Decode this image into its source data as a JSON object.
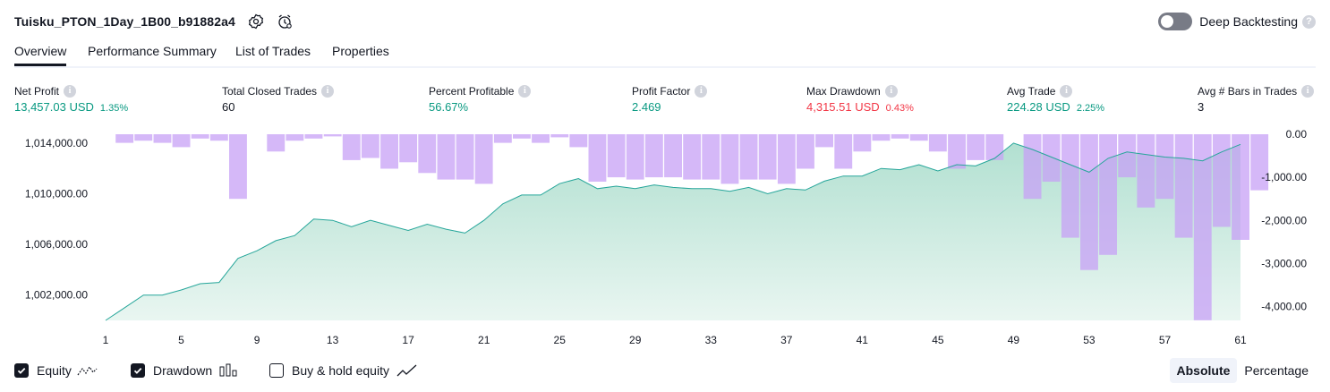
{
  "header": {
    "title": "Tuisku_PTON_1Day_1B00_b91882a4",
    "deep_backtesting_label": "Deep Backtesting",
    "deep_backtesting_enabled": false
  },
  "tabs": [
    {
      "label": "Overview",
      "active": true
    },
    {
      "label": "Performance Summary",
      "active": false
    },
    {
      "label": "List of Trades",
      "active": false
    },
    {
      "label": "Properties",
      "active": false
    }
  ],
  "metrics": [
    {
      "label": "Net Profit",
      "value": "13,457.03 USD",
      "sub": "1.35%",
      "color": "#089981"
    },
    {
      "label": "Total Closed Trades",
      "value": "60",
      "sub": "",
      "color": "#131722"
    },
    {
      "label": "Percent Profitable",
      "value": "56.67%",
      "sub": "",
      "color": "#089981"
    },
    {
      "label": "Profit Factor",
      "value": "2.469",
      "sub": "",
      "color": "#089981"
    },
    {
      "label": "Max Drawdown",
      "value": "4,315.51 USD",
      "sub": "0.43%",
      "color": "#f23645"
    },
    {
      "label": "Avg Trade",
      "value": "224.28 USD",
      "sub": "2.25%",
      "color": "#089981"
    },
    {
      "label": "Avg # Bars in Trades",
      "value": "3",
      "sub": "",
      "color": "#131722"
    }
  ],
  "chart_data": {
    "type": "area",
    "x_ticks": [
      "1",
      "5",
      "9",
      "13",
      "17",
      "21",
      "25",
      "29",
      "33",
      "37",
      "41",
      "45",
      "49",
      "53",
      "57",
      "61"
    ],
    "left_axis_ticks": [
      "1,014,000.00",
      "1,010,000.00",
      "1,006,000.00",
      "1,002,000.00"
    ],
    "right_axis_ticks": [
      "0.00",
      "-1,000.00",
      "-2,000.00",
      "-3,000.00",
      "-4,000.00"
    ],
    "equity_ylim": [
      1000000,
      1014700
    ],
    "drawdown_ylim": [
      -4320,
      0
    ],
    "trades": [
      1,
      2,
      3,
      4,
      5,
      6,
      7,
      8,
      9,
      10,
      11,
      12,
      13,
      14,
      15,
      16,
      17,
      18,
      19,
      20,
      21,
      22,
      23,
      24,
      25,
      26,
      27,
      28,
      29,
      30,
      31,
      32,
      33,
      34,
      35,
      36,
      37,
      38,
      39,
      40,
      41,
      42,
      43,
      44,
      45,
      46,
      47,
      48,
      49,
      50,
      51,
      52,
      53,
      54,
      55,
      56,
      57,
      58,
      59,
      60,
      61
    ],
    "series": [
      {
        "name": "Equity",
        "color": "#26a69a",
        "values": [
          1000000,
          1001000,
          1002000,
          1002000,
          1002400,
          1002900,
          1003000,
          1004900,
          1005500,
          1006300,
          1006700,
          1008000,
          1007900,
          1007400,
          1007900,
          1007500,
          1007100,
          1007600,
          1007200,
          1006900,
          1007900,
          1009200,
          1009900,
          1009900,
          1010800,
          1011200,
          1010400,
          1010600,
          1010400,
          1010700,
          1010500,
          1010400,
          1010400,
          1010200,
          1010500,
          1010000,
          1010400,
          1010300,
          1011000,
          1011400,
          1011400,
          1012000,
          1011900,
          1012300,
          1011800,
          1012300,
          1012200,
          1012800,
          1014000,
          1013500,
          1012900,
          1012300,
          1011700,
          1012800,
          1013300,
          1013100,
          1012900,
          1012800,
          1012600,
          1013300,
          1013900
        ]
      },
      {
        "name": "Drawdown",
        "color": "#c7a0f5",
        "values": [
          0,
          -200,
          -150,
          -200,
          -300,
          -100,
          -150,
          -1500,
          0,
          -400,
          -150,
          -100,
          -50,
          -600,
          -550,
          -800,
          -650,
          -900,
          -1050,
          -1050,
          -1150,
          -200,
          -100,
          -200,
          -70,
          -300,
          -1100,
          -1000,
          -1050,
          -1000,
          -1000,
          -1050,
          -1050,
          -1150,
          -1050,
          -1050,
          -1150,
          -800,
          -300,
          -800,
          -400,
          -150,
          -100,
          -150,
          -400,
          -800,
          -600,
          -600,
          0,
          -1500,
          -1100,
          -2400,
          -3150,
          -2800,
          -1000,
          -1700,
          -1500,
          -2400,
          -4315,
          -2150,
          -2450,
          -1300
        ]
      }
    ]
  },
  "legend": [
    {
      "label": "Equity",
      "checked": true
    },
    {
      "label": "Drawdown",
      "checked": true
    },
    {
      "label": "Buy & hold equity",
      "checked": false
    }
  ],
  "view_mode": {
    "options": [
      "Absolute",
      "Percentage"
    ],
    "selected": "Absolute"
  }
}
